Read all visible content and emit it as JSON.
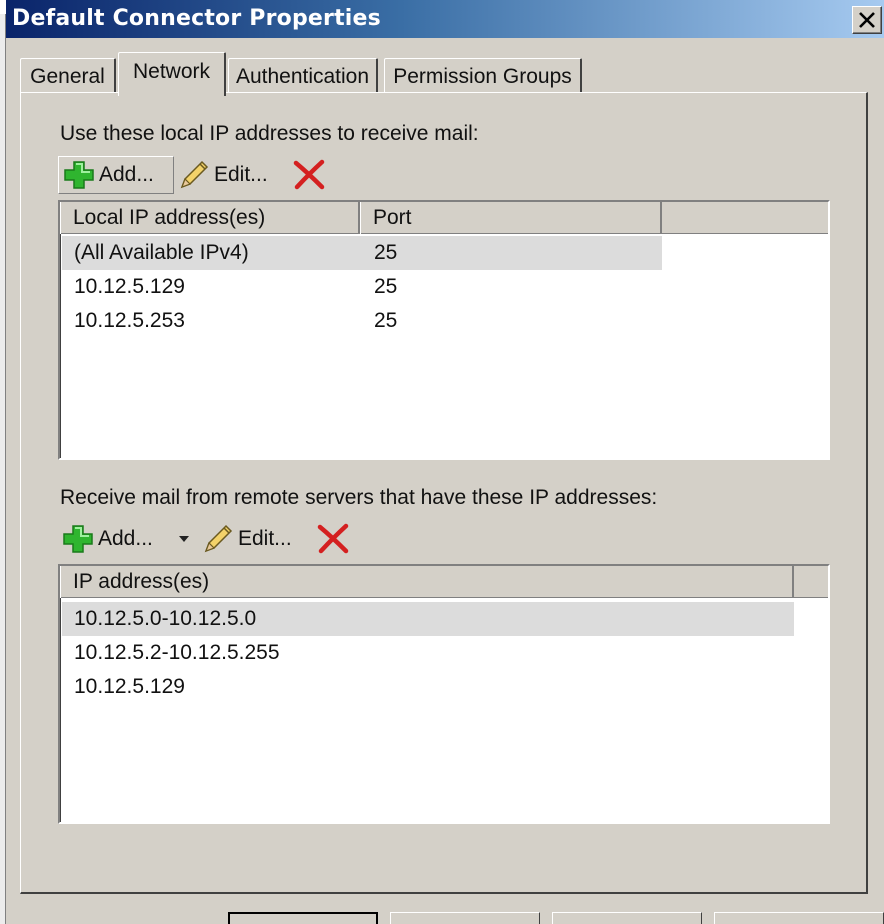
{
  "window": {
    "title": "Default Connector Properties"
  },
  "tabs": [
    {
      "label": "General"
    },
    {
      "label": "Network"
    },
    {
      "label": "Authentication"
    },
    {
      "label": "Permission Groups"
    }
  ],
  "local_section": {
    "heading": "Use these local IP addresses to receive mail:",
    "add_label": "Add...",
    "edit_label": "Edit...",
    "columns": [
      "Local IP address(es)",
      "Port"
    ],
    "rows": [
      {
        "address": "(All Available IPv4)",
        "port": "25",
        "selected": true
      },
      {
        "address": "10.12.5.129",
        "port": "25",
        "selected": false
      },
      {
        "address": "10.12.5.253",
        "port": "25",
        "selected": false
      }
    ]
  },
  "remote_section": {
    "heading": "Receive mail from remote servers that have these IP addresses:",
    "add_label": "Add...",
    "edit_label": "Edit...",
    "columns": [
      "IP address(es)"
    ],
    "rows": [
      {
        "address": "10.12.5.0-10.12.5.0",
        "selected": true
      },
      {
        "address": "10.12.5.2-10.12.5.255",
        "selected": false
      },
      {
        "address": "10.12.5.129",
        "selected": false
      }
    ]
  },
  "colors": {
    "title_gradient_start": "#0a246a",
    "title_gradient_end": "#a6caf0",
    "add_icon": "#2fb52f",
    "delete_icon": "#d42020",
    "selection": "#dcdcdc"
  },
  "icons": [
    "close-icon",
    "add-plus-icon",
    "edit-pencil-icon",
    "delete-x-icon",
    "chevron-down-icon"
  ]
}
